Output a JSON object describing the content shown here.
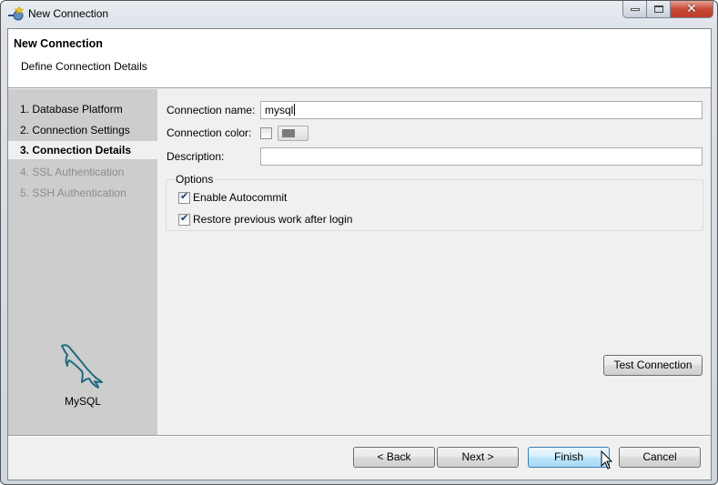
{
  "window": {
    "title": "New Connection",
    "controls": [
      "minimize",
      "maximize",
      "close"
    ]
  },
  "header": {
    "title": "New Connection",
    "subtitle": "Define Connection Details"
  },
  "steps": [
    {
      "label": "1. Database Platform",
      "state": "done"
    },
    {
      "label": "2. Connection Settings",
      "state": "done"
    },
    {
      "label": "3. Connection Details",
      "state": "active"
    },
    {
      "label": "4. SSL Authentication",
      "state": "disabled"
    },
    {
      "label": "5. SSH Authentication",
      "state": "disabled"
    }
  ],
  "platform": {
    "name": "MySQL",
    "icon": "mysql-dolphin-icon",
    "color": "#1f6b80"
  },
  "form": {
    "connection_name_label": "Connection name:",
    "connection_name_value": "mysql",
    "connection_color_label": "Connection color:",
    "connection_color_enabled": false,
    "connection_color_swatch": "#7a7a7a",
    "description_label": "Description:",
    "description_value": "",
    "options_legend": "Options",
    "options": [
      {
        "label": "Enable Autocommit",
        "checked": true
      },
      {
        "label": "Restore previous work after login",
        "checked": true
      }
    ],
    "test_connection_label": "Test Connection"
  },
  "footer": {
    "back_label": "< Back",
    "next_label": "Next >",
    "finish_label": "Finish",
    "cancel_label": "Cancel"
  }
}
